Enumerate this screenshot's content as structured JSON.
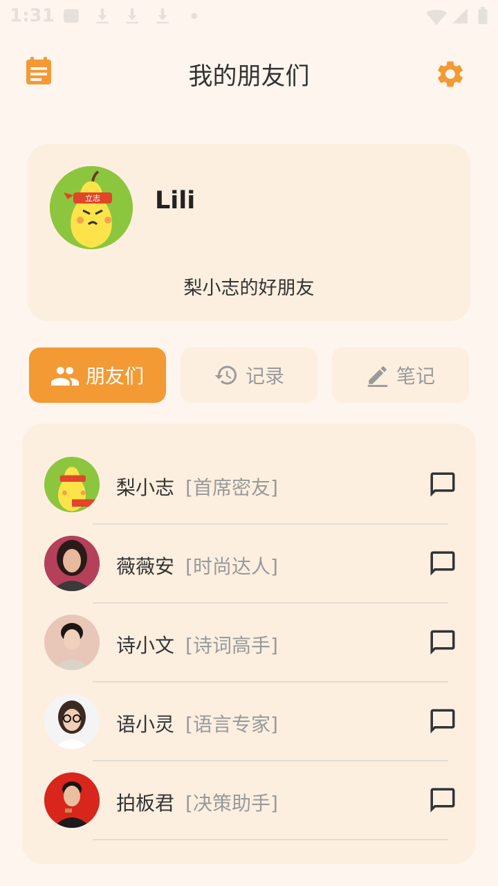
{
  "status_bar": {
    "time": "1:31"
  },
  "header": {
    "title": "我的朋友们",
    "left_icon": "calendar-note-icon",
    "right_icon": "gear-icon"
  },
  "profile": {
    "name": "Lili",
    "signature": "梨小志的好朋友",
    "headband_text": "立志"
  },
  "tabs": [
    {
      "label": "朋友们",
      "icon": "people-icon",
      "active": true
    },
    {
      "label": "记录",
      "icon": "history-icon",
      "active": false
    },
    {
      "label": "笔记",
      "icon": "edit-icon",
      "active": false
    }
  ],
  "friends": [
    {
      "name": "梨小志",
      "role": "[首席密友]"
    },
    {
      "name": "薇薇安",
      "role": "[时尚达人]"
    },
    {
      "name": "诗小文",
      "role": "[诗词高手]"
    },
    {
      "name": "语小灵",
      "role": "[语言专家]"
    },
    {
      "name": "拍板君",
      "role": "[决策助手]"
    }
  ],
  "colors": {
    "accent": "#f39a34",
    "card": "#fcefe0",
    "background": "#fdf5ee"
  }
}
